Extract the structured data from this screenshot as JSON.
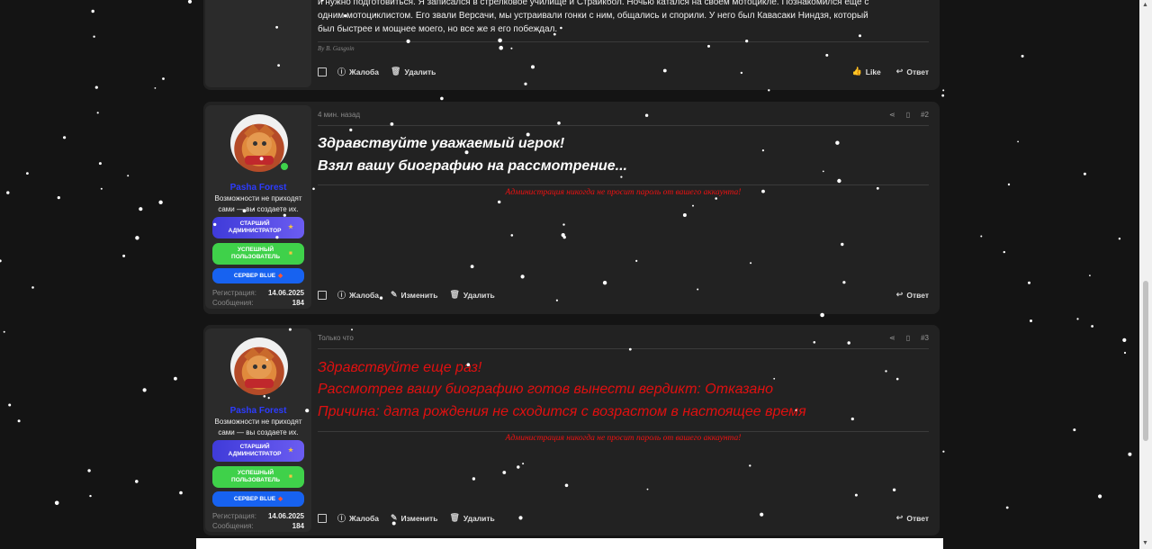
{
  "post0": {
    "text_line1": "и нужно подготовиться. Я записался в стрелковое училище и Страйкбол. Ночью катался на своем мотоцикле. Познакомился еще с",
    "text_line2": "одним мотоциклистом. Его звали Версачи, мы устраивали гонки с ним, общались и спорили. У него был Кавасаки Ниндзя, который",
    "text_line3": "был быстрее и мощнее моего, но все же я его побеждал.",
    "byline": "By B. Gasgoin",
    "actions": {
      "report": "Жалоба",
      "delete": "Удалить",
      "like": "Like",
      "reply": "Ответ"
    }
  },
  "user": {
    "name": "Pasha Forest",
    "title": "Возможности не приходят сами — вы создаете их.",
    "badge1": "СТАРШИЙ АДМИНИСТРАТОР",
    "badge2": "УСПЕШНЫЙ ПОЛЬЗОВАТЕЛЬ",
    "badge3": "СЕРВЕР BLUE",
    "reg_label": "Регистрация:",
    "reg_value": "14.06.2025",
    "msg_label": "Сообщения:",
    "msg_value": "184"
  },
  "post2": {
    "time": "4 мин. назад",
    "number": "#2",
    "line1": "Здравствуйте уважаемый игрок!",
    "line2": "Взял вашу биографию на рассмотрение...",
    "signature": "Администрация никогда не просит пароль от вашего аккаунта!",
    "actions": {
      "report": "Жалоба",
      "edit": "Изменить",
      "delete": "Удалить",
      "reply": "Ответ"
    }
  },
  "post3": {
    "time": "Только что",
    "number": "#3",
    "line1": "Здравствуйте еще раз!",
    "line2": "Рассмотрев вашу биографию готов вынести вердикт: Отказано",
    "line3": "Причина: дата рождения не сходится с возрастом в настоящее время",
    "signature": "Администрация никогда не просит пароль от вашего аккаунта!",
    "actions": {
      "report": "Жалоба",
      "edit": "Изменить",
      "delete": "Удалить",
      "reply": "Ответ"
    }
  },
  "colors": {
    "background": "#141414",
    "post": "#222222",
    "username": "#2d3cff",
    "warning": "#e01010"
  }
}
